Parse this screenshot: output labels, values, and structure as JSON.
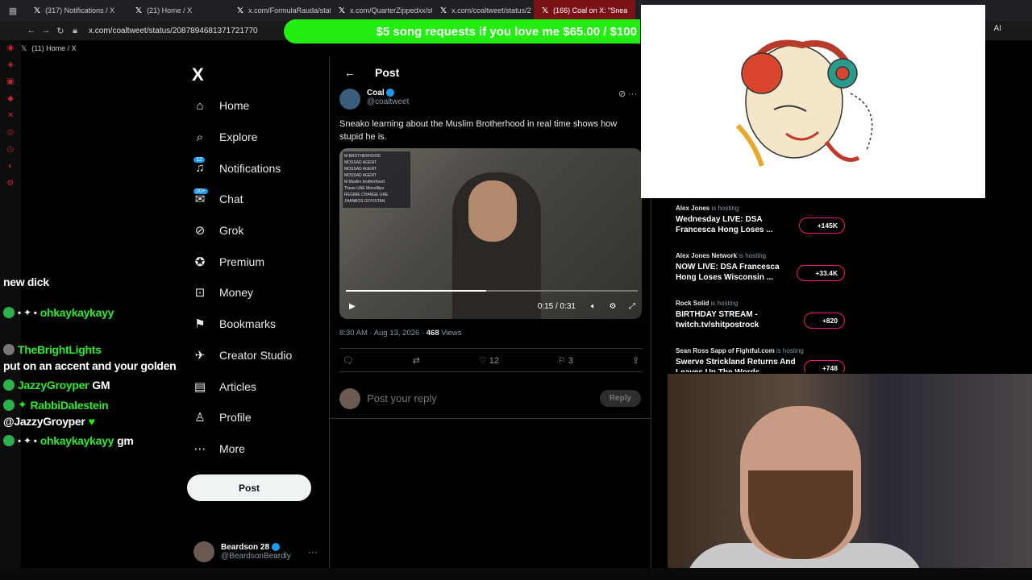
{
  "browser": {
    "tabs": [
      {
        "label": "(317) Notifications / X",
        "active": false
      },
      {
        "label": "(21) Home / X",
        "active": false
      },
      {
        "label": "x.com/FormulaRauda/stat",
        "active": false
      },
      {
        "label": "x.com/QuarterZippedxx/st",
        "active": false
      },
      {
        "label": "x.com/coaltweet/status/2",
        "active": false
      },
      {
        "label": "(166) Coal on X: \"Snea",
        "active": true
      }
    ],
    "url": "x.com/coaltweet/status/2087894681371721770",
    "bookmark": "(11) Home / X",
    "ai_label": "AI"
  },
  "banner": {
    "text": "$5 song requests if you love me $65.00 / $100"
  },
  "nav": {
    "logo": "X",
    "items": [
      {
        "label": "Home",
        "icon": "⌂",
        "badge": ""
      },
      {
        "label": "Explore",
        "icon": "⌕",
        "badge": ""
      },
      {
        "label": "Notifications",
        "icon": "♫",
        "badge": "12"
      },
      {
        "label": "Chat",
        "icon": "✉",
        "badge": "20+"
      },
      {
        "label": "Grok",
        "icon": "⊘",
        "badge": ""
      },
      {
        "label": "Premium",
        "icon": "✪",
        "badge": ""
      },
      {
        "label": "Money",
        "icon": "⊡",
        "badge": ""
      },
      {
        "label": "Bookmarks",
        "icon": "⚑",
        "badge": ""
      },
      {
        "label": "Creator Studio",
        "icon": "✈",
        "badge": ""
      },
      {
        "label": "Articles",
        "icon": "▤",
        "badge": ""
      },
      {
        "label": "Profile",
        "icon": "♙",
        "badge": ""
      },
      {
        "label": "More",
        "icon": "⋯",
        "badge": ""
      }
    ],
    "post_button": "Post",
    "account": {
      "name": "Beardson 28",
      "handle": "@BeardsonBeardly"
    }
  },
  "post": {
    "header": "Post",
    "author": "Coal",
    "handle": "@coaltweet",
    "text": "Sneako learning about the Muslim Brotherhood in real time shows how stupid he is.",
    "video": {
      "overlay": [
        "M BROTHERHOOD",
        "MOSSAD AGENT",
        "MOSSAD AGENT",
        "MOSSAD AGENT",
        "M Muslim brotherhood",
        "These UAE Monofilips",
        "REGIME CHANGE UAE",
        "JHANBOS GOYISTAN"
      ],
      "time": "0:15 / 0:31",
      "progress": 0.48
    },
    "timestamp": "8:30 AM · Aug 13, 2026 · ",
    "views": "468",
    "views_label": " Views",
    "likes": "12",
    "bookmarks": "3",
    "reply_placeholder": "Post your reply",
    "reply_button": "Reply"
  },
  "live": [
    {
      "host": "Alex Jones",
      "hosting": "is hosting",
      "title": "Wednesday LIVE: DSA Francesca Hong Loses ...",
      "count": "+145K"
    },
    {
      "host": "Alex Jones Network",
      "hosting": "is hosting",
      "title": "NOW LIVE: DSA Francesca Hong Loses Wisconsin ...",
      "count": "+33.4K"
    },
    {
      "host": "Rock Solid",
      "hosting": "is hosting",
      "title": "BIRTHDAY STREAM - twitch.tv/shitpostrock",
      "count": "+820"
    },
    {
      "host": "Sean Ross Sapp of Fightful.com",
      "hosting": "is hosting",
      "title": "Swerve Strickland Returns And Leaves Up The Words",
      "count": "+748"
    }
  ],
  "chat": [
    {
      "user": "",
      "text": "new dick"
    },
    {
      "user": "ohkaykaykayy",
      "text": ""
    },
    {
      "user": "TheBrightLights",
      "text": "put on an accent and your golden"
    },
    {
      "user": "JazzyGroyper",
      "text": "GM"
    },
    {
      "user": "RabbiDalestein",
      "text": "@JazzyGroyper"
    },
    {
      "user": "ohkaykaykayy",
      "text": "gm"
    }
  ],
  "colors": {
    "accent": "#1d9bf0",
    "chat_name": "#2fe82f",
    "banner": "#22ee11",
    "live_pill": "#f91880"
  }
}
